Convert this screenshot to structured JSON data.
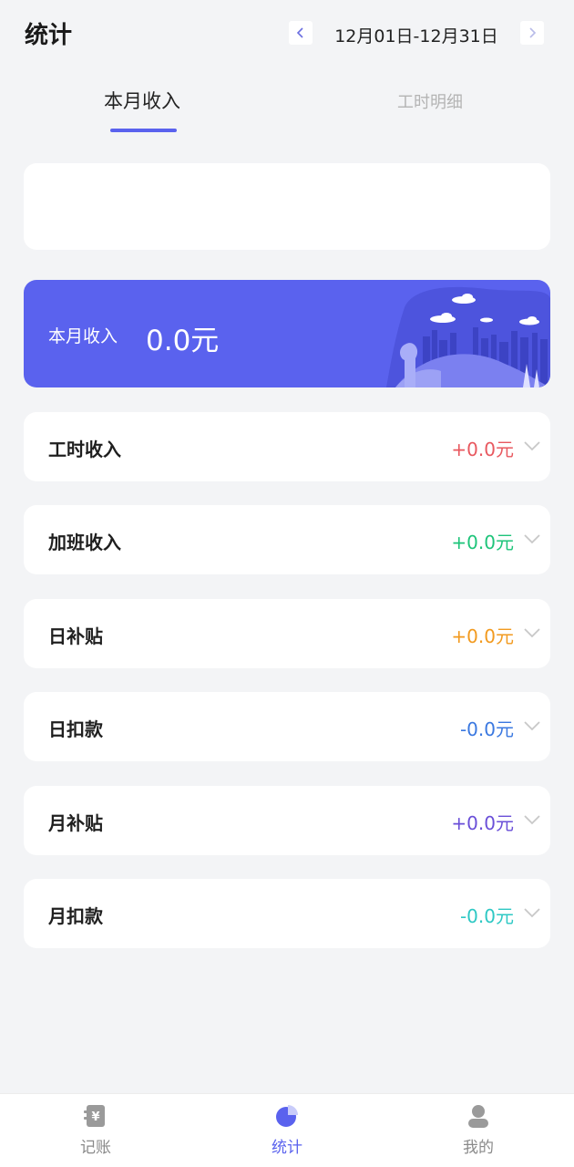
{
  "header": {
    "title": "统计",
    "date_range": "12月01日-12月31日",
    "prev_icon": "chevron-left-icon",
    "next_icon": "chevron-right-icon"
  },
  "tabs": [
    {
      "label": "本月收入",
      "active": true
    },
    {
      "label": "工时明细",
      "active": false
    }
  ],
  "banner": {
    "label": "本月收入",
    "amount": "0.0元",
    "color": "#5a62ee"
  },
  "rows": [
    {
      "name": "工时收入",
      "value": "+0.0元",
      "color": "#e8585f"
    },
    {
      "name": "加班收入",
      "value": "+0.0元",
      "color": "#1ec47a"
    },
    {
      "name": "日补贴",
      "value": "+0.0元",
      "color": "#f29a1f"
    },
    {
      "name": "日扣款",
      "value": "-0.0元",
      "color": "#3a78e0"
    },
    {
      "name": "月补贴",
      "value": "+0.0元",
      "color": "#6a4fd8"
    },
    {
      "name": "月扣款",
      "value": "-0.0元",
      "color": "#2ec8c4"
    }
  ],
  "bottom_nav": [
    {
      "label": "记账",
      "icon": "ledger-icon",
      "active": false
    },
    {
      "label": "统计",
      "icon": "pie-chart-icon",
      "active": true
    },
    {
      "label": "我的",
      "icon": "user-icon",
      "active": false
    }
  ]
}
